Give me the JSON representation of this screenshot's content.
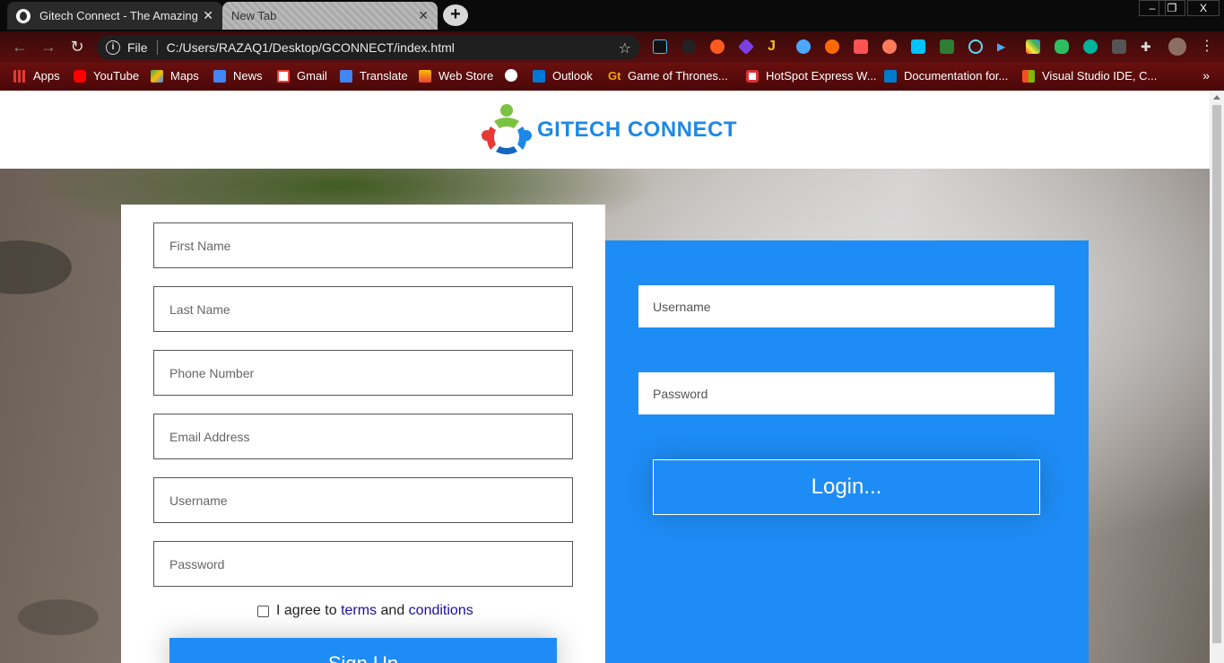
{
  "browser": {
    "tabs": [
      {
        "title": "Gitech Connect - The Amazing S",
        "active": true
      },
      {
        "title": "New Tab",
        "active": false
      }
    ],
    "new_tab": "+",
    "window_controls": {
      "minimize": "–",
      "restore": "❐",
      "close": "X"
    },
    "address": {
      "scheme_label": "File",
      "url": "C:/Users/RAZAQ1/Desktop/GCONNECT/index.html"
    },
    "bookmarks": [
      {
        "label": "Apps",
        "icon": "apps-grid-icon",
        "color": "#e53935"
      },
      {
        "label": "YouTube",
        "icon": "youtube-icon",
        "color": "#ff0000"
      },
      {
        "label": "Maps",
        "icon": "maps-icon",
        "color": "#34a853"
      },
      {
        "label": "News",
        "icon": "news-icon",
        "color": "#4285f4"
      },
      {
        "label": "Gmail",
        "icon": "gmail-icon",
        "color": "#ea4335"
      },
      {
        "label": "Translate",
        "icon": "translate-icon",
        "color": "#4285f4"
      },
      {
        "label": "Web Store",
        "icon": "web-store-icon",
        "color": "#f4b400"
      },
      {
        "label": "",
        "icon": "globe-icon",
        "color": "#ffffff"
      },
      {
        "label": "Outlook",
        "icon": "outlook-icon",
        "color": "#0078d4"
      },
      {
        "label": "Game of Thrones...",
        "icon": "got-icon",
        "color": "#f7a600"
      },
      {
        "label": "HotSpot Express W...",
        "icon": "hotspot-icon",
        "color": "#ffffff"
      },
      {
        "label": "Documentation for...",
        "icon": "vscode-icon",
        "color": "#007acc"
      },
      {
        "label": "Visual Studio IDE, C...",
        "icon": "windows-icon",
        "color": "#00a4ef"
      }
    ],
    "bookmarks_more": "»"
  },
  "page": {
    "brand": "GITECH CONNECT",
    "signup": {
      "first_name_placeholder": "First Name",
      "last_name_placeholder": "Last Name",
      "phone_placeholder": "Phone Number",
      "email_placeholder": "Email Address",
      "username_placeholder": "Username",
      "password_placeholder": "Password",
      "agree_prefix": "I agree to",
      "terms_link": "terms",
      "agree_and": "and",
      "conditions_link": "conditions",
      "submit_label": "Sign Up"
    },
    "login": {
      "username_placeholder": "Username",
      "password_placeholder": "Password",
      "submit_label": "Login..."
    }
  },
  "colors": {
    "accent_blue": "#1e8cf5",
    "brand_text": "#1e88e5",
    "link": "#1a0dab"
  }
}
